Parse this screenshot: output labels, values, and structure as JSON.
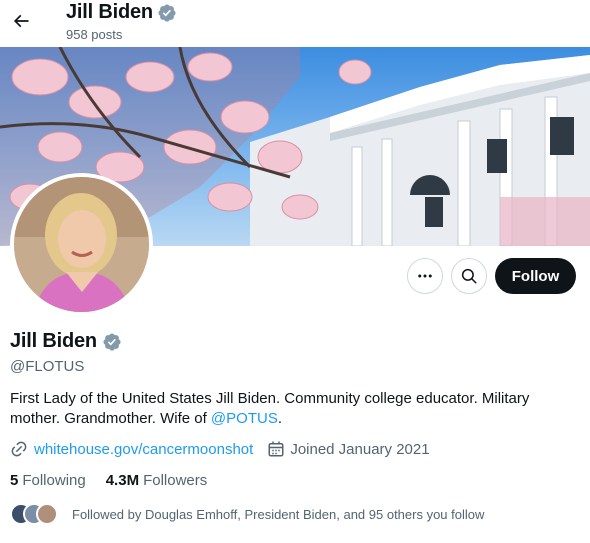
{
  "header": {
    "back_icon": "arrow-left-icon",
    "name": "Jill Biden",
    "posts": "958 posts"
  },
  "profile": {
    "name": "Jill Biden",
    "handle": "@FLOTUS",
    "bio_text": "First Lady of the United States Jill Biden. Community college educator. Military mother. Grandmother. Wife of ",
    "bio_mention": "@POTUS",
    "bio_end": ".",
    "website": "whitehouse.gov/cancermoonshot",
    "joined": "Joined January 2021",
    "following_count": "5",
    "following_label": "Following",
    "followers_count": "4.3M",
    "followers_label": "Followers",
    "followed_by": "Followed by Douglas Emhoff, President Biden, and 95 others you follow"
  },
  "actions": {
    "more_icon": "more-icon",
    "search_icon": "search-icon",
    "follow_label": "Follow"
  },
  "colors": {
    "accent": "#1d9bf0",
    "verified": "#829aab",
    "text": "#0f1419",
    "secondary": "#536471"
  }
}
